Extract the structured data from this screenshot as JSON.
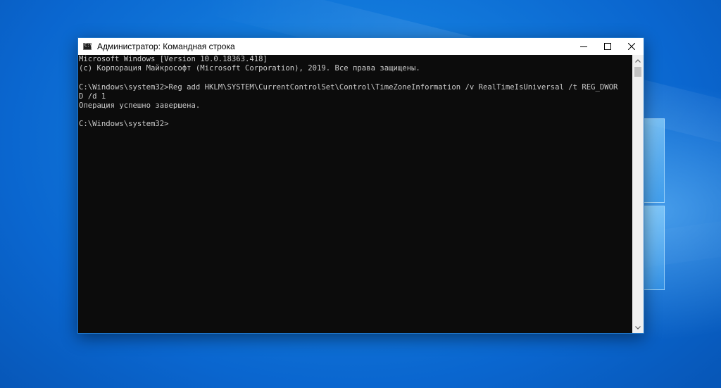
{
  "window": {
    "title": "Администратор: Командная строка",
    "icon": "cmd-icon"
  },
  "controls": {
    "minimize_icon": "minimize-icon",
    "maximize_icon": "maximize-icon",
    "close_icon": "close-icon"
  },
  "console": {
    "lines": [
      "Microsoft Windows [Version 10.0.18363.418]",
      "(c) Корпорация Майкрософт (Microsoft Corporation), 2019. Все права защищены.",
      "",
      "C:\\Windows\\system32>Reg add HKLM\\SYSTEM\\CurrentControlSet\\Control\\TimeZoneInformation /v RealTimeIsUniversal /t REG_DWOR",
      "D /d 1",
      "Операция успешно завершена.",
      "",
      "C:\\Windows\\system32>"
    ]
  },
  "colors": {
    "console_bg": "#0c0c0c",
    "console_text": "#cccccc",
    "desktop_accent": "#0a6fd6"
  }
}
